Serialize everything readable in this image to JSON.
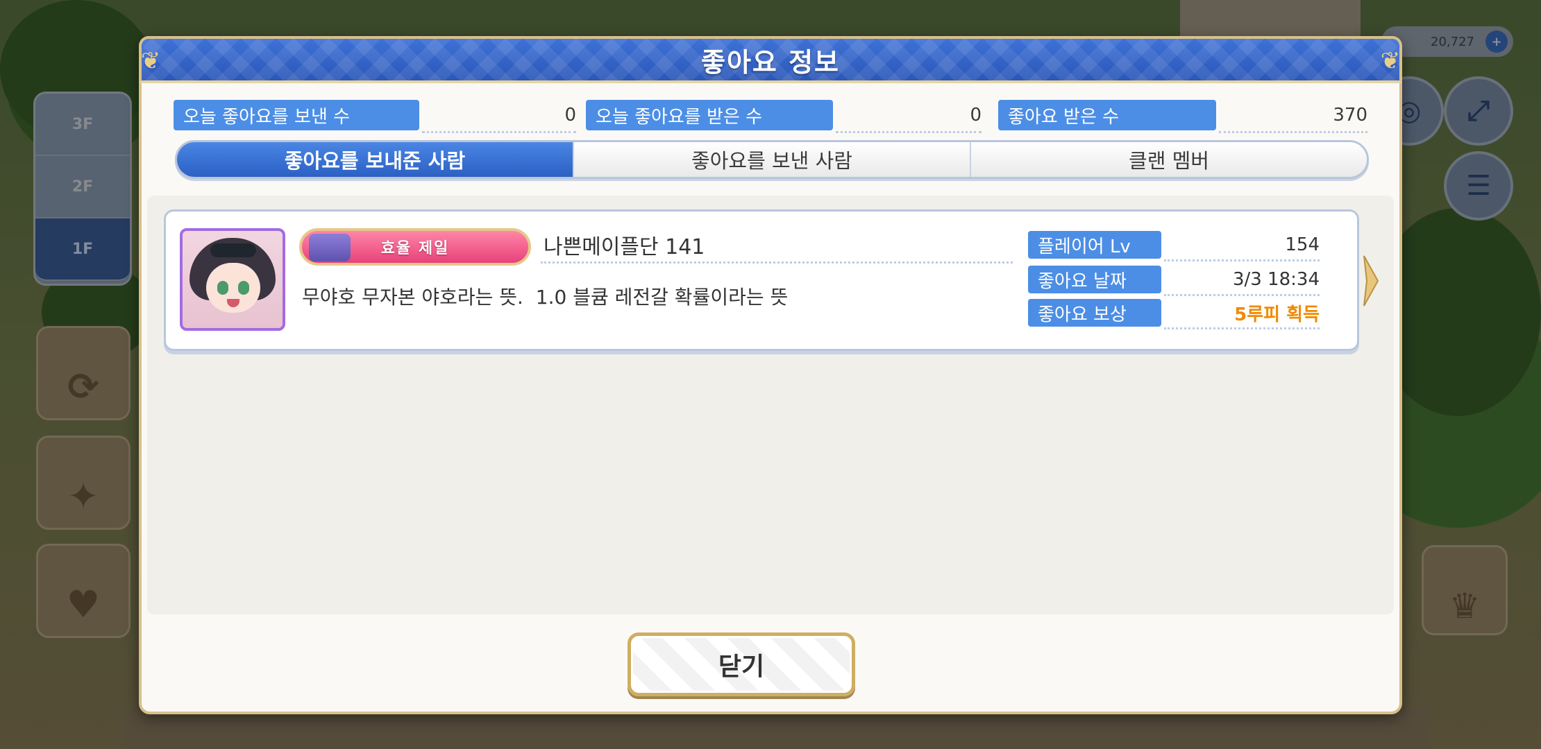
{
  "dialog": {
    "title": "좋아요 정보",
    "stats": [
      {
        "label": "오늘 좋아요를 보낸 수",
        "value": "0"
      },
      {
        "label": "오늘 좋아요를 받은 수",
        "value": "0"
      },
      {
        "label": "좋아요 받은 수",
        "value": "370"
      }
    ],
    "tabs": [
      {
        "label": "좋아요를 보내준 사람",
        "active": true
      },
      {
        "label": "좋아요를 보낸 사람",
        "active": false
      },
      {
        "label": "클랜 멤버",
        "active": false
      }
    ],
    "entries": [
      {
        "title_badge": "효율 제일",
        "player_name": "나쁜메이플단 141",
        "comment": "무야호 무자본 야호라는 뜻.  1.0 블큠 레전갈 확률이라는 뜻",
        "info": [
          {
            "label": "플레이어 Lv",
            "value": "154"
          },
          {
            "label": "좋아요 날짜",
            "value": "3/3 18:34"
          },
          {
            "label": "좋아요 보상",
            "value": "5루피 획득"
          }
        ]
      }
    ],
    "close_label": "닫기"
  },
  "colors": {
    "header_blue": "#2b57b8",
    "label_blue": "#4c8ee6",
    "reward_orange": "#f08a00",
    "frame_gold": "#d8c08a"
  },
  "background": {
    "floors": [
      "3F",
      "2F",
      "1F"
    ],
    "currency": "20,727"
  }
}
